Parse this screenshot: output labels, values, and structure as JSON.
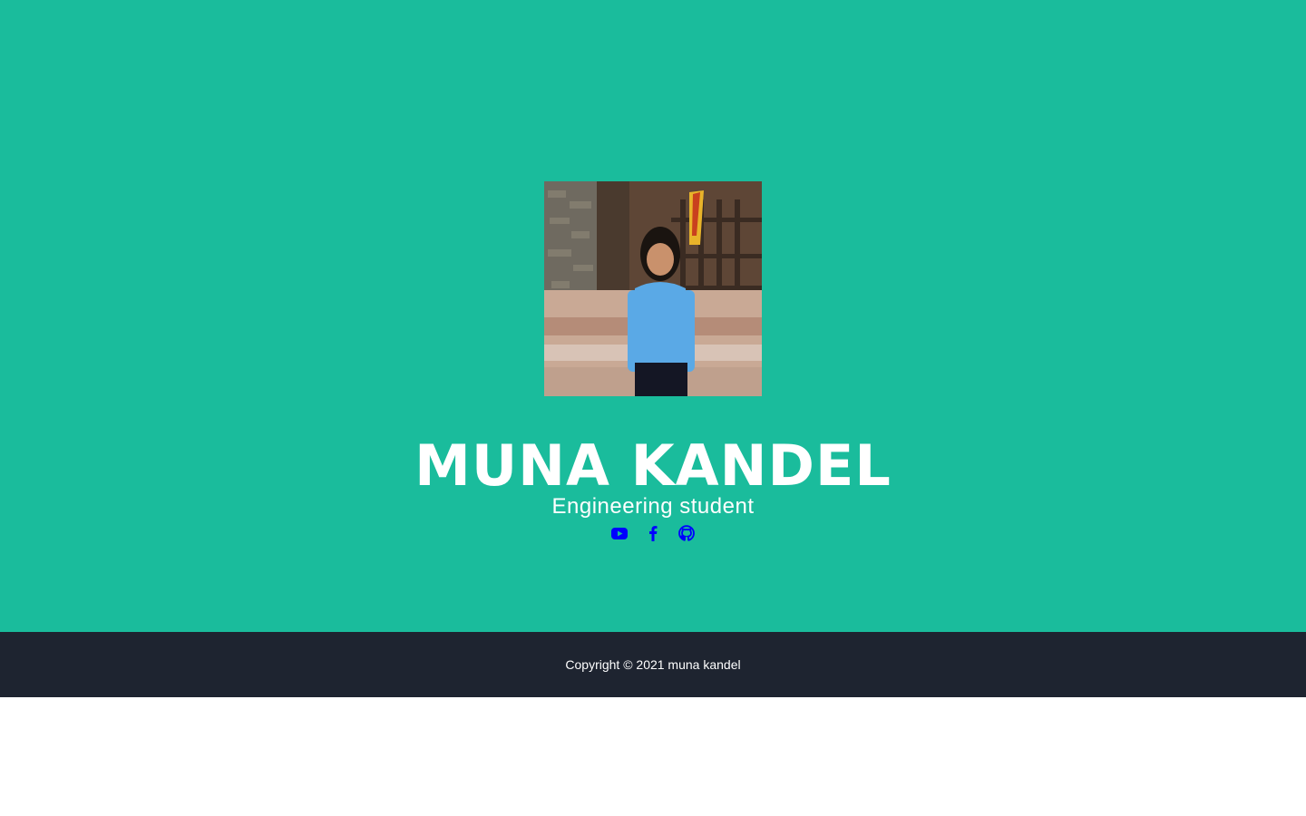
{
  "profile": {
    "name": "MUNA KANDEL",
    "title": "Engineering student",
    "photo_icon": "profile-photo"
  },
  "social": [
    {
      "icon": "youtube-icon",
      "color": "#0000ff"
    },
    {
      "icon": "facebook-icon",
      "color": "#0000ff"
    },
    {
      "icon": "github-icon",
      "color": "#0000ff"
    }
  ],
  "footer": {
    "copyright": "Copyright © 2021 muna kandel"
  },
  "colors": {
    "hero_bg": "#1abc9c",
    "footer_bg": "#1e2430",
    "text": "#ffffff",
    "icon": "#0000ff"
  }
}
